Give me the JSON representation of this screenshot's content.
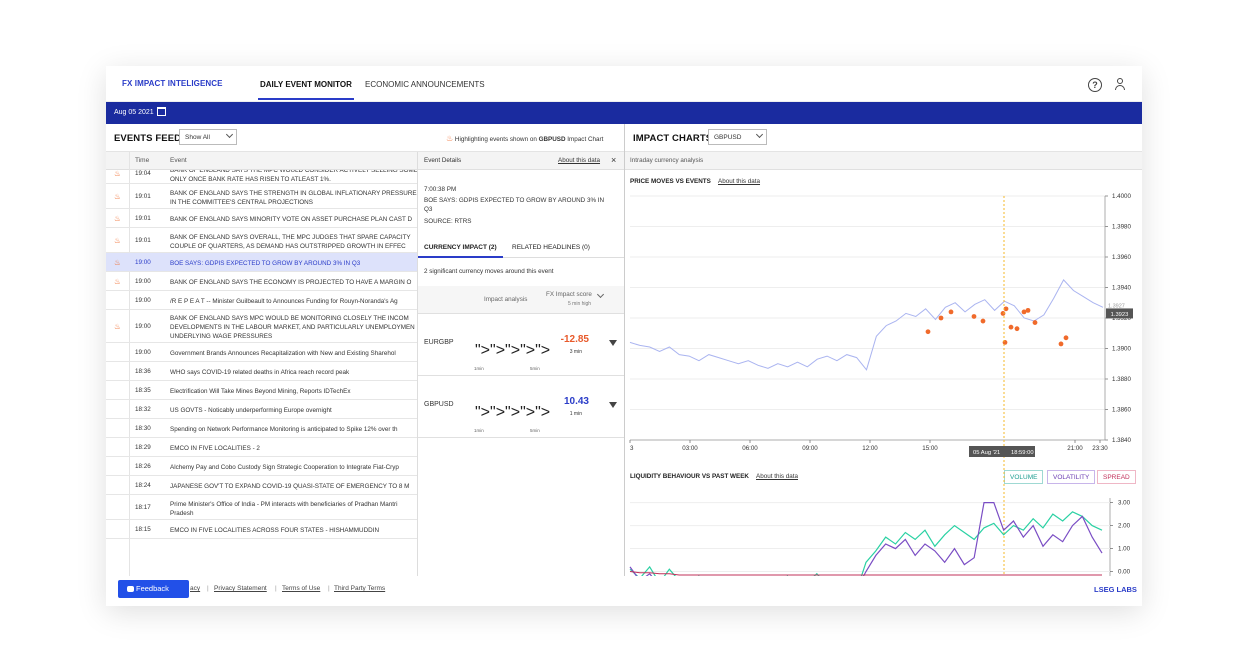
{
  "nav": {
    "brand": "FX IMPACT INTELIGENCE",
    "tab_daily": "DAILY EVENT MONITOR",
    "tab_econ": "ECONOMIC ANNOUNCEMENTS"
  },
  "datebar": {
    "date": "Aug 05 2021"
  },
  "feed": {
    "title": "EVENTS FEED",
    "filter": "Show All",
    "highlight_prefix": "Highlighting events shown on ",
    "highlight_pair": "GBPUSD",
    "highlight_suffix": " Impact Chart",
    "col_time": "Time",
    "col_event": "Event",
    "rows": [
      {
        "time": "19:04",
        "flame": true,
        "l1": "BANK OF ENGLAND SAYS THE MPC WOULD CONSIDER ACTIVELY SELLING SOME",
        "l2": "ONLY ONCE BANK RATE HAS RISEN TO ATLEAST 1%."
      },
      {
        "time": "19:01",
        "flame": true,
        "l1": "BANK OF ENGLAND SAYS THE STRENGTH IN GLOBAL INFLATIONARY PRESSURES",
        "l2": "IN THE COMMITTEE'S CENTRAL PROJECTIONS"
      },
      {
        "time": "19:01",
        "flame": true,
        "l1": "BANK OF ENGLAND SAYS MINORITY VOTE ON ASSET PURCHASE PLAN CAST D",
        "l2": ""
      },
      {
        "time": "19:01",
        "flame": true,
        "l1": "BANK OF ENGLAND SAYS OVERALL, THE MPC JUDGES THAT SPARE CAPACITY",
        "l2": "COUPLE OF     QUARTERS, AS DEMAND HAS OUTSTRIPPED GROWTH IN EFFEC"
      },
      {
        "time": "19:00",
        "flame": true,
        "l1": "BOE SAYS: GDPIS EXPECTED TO GROW BY AROUND 3% IN Q3",
        "l2": ""
      },
      {
        "time": "19:00",
        "flame": true,
        "l1": "BANK OF ENGLAND SAYS THE ECONOMY IS PROJECTED TO HAVE A MARGIN O",
        "l2": ""
      },
      {
        "time": "19:00",
        "flame": false,
        "l1": "/R E P E A T -- Minister Guilbeault to Announces Funding for Rouyn-Noranda's Ag",
        "l2": ""
      },
      {
        "time": "19:00",
        "flame": true,
        "l1": "BANK OF ENGLAND SAYS MPC WOULD BE MONITORING CLOSELY THE INCOM",
        "l2": "DEVELOPMENTS IN THE LABOUR MARKET, AND PARTICULARLY UNEMPLOYMEN",
        "l3": "UNDERLYING WAGE PRESSURES"
      },
      {
        "time": "19:00",
        "flame": false,
        "l1": "Government Brands Announces Recapitalization with New and Existing Sharehol",
        "l2": ""
      },
      {
        "time": "18:36",
        "flame": false,
        "l1": "WHO says COVID-19 related deaths in Africa reach record peak",
        "l2": ""
      },
      {
        "time": "18:35",
        "flame": false,
        "l1": "Electrification Will Take Mines Beyond Mining, Reports IDTechEx",
        "l2": ""
      },
      {
        "time": "18:32",
        "flame": false,
        "l1": "US GOVTS - Noticably underperforming Europe overnight",
        "l2": ""
      },
      {
        "time": "18:30",
        "flame": false,
        "l1": "Spending on Network Performance Monitoring is anticipated to Spike 12% over th",
        "l2": ""
      },
      {
        "time": "18:29",
        "flame": false,
        "l1": "EMCO IN FIVE LOCALITIES - 2",
        "l2": ""
      },
      {
        "time": "18:26",
        "flame": false,
        "l1": "Alchemy Pay and Cobo Custody Sign Strategic Cooperation to Integrate Fiat-Cryp",
        "l2": ""
      },
      {
        "time": "18:24",
        "flame": false,
        "l1": "JAPANESE GOV'T TO EXPAND COVID-19 QUASI-STATE OF EMERGENCY TO 8 M",
        "l2": ""
      },
      {
        "time": "18:17",
        "flame": false,
        "l1": "Prime Minister's Office of India - PM interacts with beneficiaries of Pradhan Mantri",
        "l2": "Pradesh"
      },
      {
        "time": "18:15",
        "flame": false,
        "l1": "EMCO IN FIVE LOCALITIES ACROSS FOUR STATES - HISHAMMUDDIN",
        "l2": ""
      }
    ]
  },
  "details": {
    "title": "Event Details",
    "about": "About this data",
    "time": "7:00:38 PM",
    "headline1": "BOE SAYS: GDPIS EXPECTED TO GROW BY AROUND 3% IN",
    "headline2": "Q3",
    "source": "SOURCE: RTRS",
    "tab_impact": "CURRENCY IMPACT (2)",
    "tab_headlines": "RELATED HEADLINES (0)",
    "summary": "2 significant currency moves around this event",
    "col_analysis": "Impact analysis",
    "col_score": "FX Impact score",
    "col_score_sub": "5 min high",
    "pairs": [
      {
        "name": "EURGBP",
        "score": "-12.85",
        "window": "3 min",
        "color": "#e85a2b",
        "bar": "#f6b8a6",
        "lbl1": "1min",
        "lbl2": "5min"
      },
      {
        "name": "GBPUSD",
        "score": "10.43",
        "window": "1 min",
        "color": "#2a3cc8",
        "bar": "#b9bff4",
        "lbl1": "1min",
        "lbl2": "5min"
      }
    ]
  },
  "charts": {
    "title": "IMPACT CHARTS",
    "pair": "GBPUSD",
    "subtitle": "Intraday currency analysis",
    "price_title": "PRICE MOVES VS EVENTS",
    "price_about": "About this data",
    "liq_title": "LIQUIDITY BEHAVIOUR VS PAST WEEK",
    "liq_about": "About this data",
    "toggle_volume": "VOLUME",
    "toggle_volatility": "VOLATILITY",
    "toggle_spread": "SPREAD",
    "crosshair_date": "05 Aug '21",
    "crosshair_time": "18:59:00",
    "price_tag": "1.3923",
    "price_tag_faded": "1.3927"
  },
  "chart_data": [
    {
      "type": "line",
      "title": "PRICE MOVES VS EVENTS",
      "x_ticks": [
        "3",
        "03:00",
        "06:00",
        "09:00",
        "12:00",
        "15:00",
        "21:00",
        "23:30"
      ],
      "y_ticks": [
        "1.4000",
        "1.3980",
        "1.3960",
        "1.3940",
        "1.3920",
        "1.3900",
        "1.3880",
        "1.3860",
        "1.3840"
      ],
      "ylim": [
        1.384,
        1.4
      ],
      "series": [
        {
          "values": [
            1.3904,
            1.3902,
            1.3901,
            1.3898,
            1.3901,
            1.3896,
            1.3895,
            1.3892,
            1.3896,
            1.3894,
            1.3892,
            1.389,
            1.3892,
            1.3889,
            1.3887,
            1.389,
            1.3888,
            1.3891,
            1.3888,
            1.3893,
            1.3895,
            1.3892,
            1.3896,
            1.3894,
            1.3886,
            1.3908,
            1.3915,
            1.3918,
            1.3923,
            1.3921,
            1.3926,
            1.3919,
            1.3927,
            1.393,
            1.3924,
            1.3929,
            1.3932,
            1.3925,
            1.3931,
            1.3928,
            1.392,
            1.3918,
            1.3922,
            1.3933,
            1.3945,
            1.3938,
            1.3934,
            1.393,
            1.3927
          ]
        }
      ],
      "events": [
        1.3911,
        1.392,
        1.3924,
        1.3921,
        1.3918,
        1.3923,
        1.3926,
        1.3904,
        1.3914,
        1.3913,
        1.3924,
        1.3925,
        1.3917,
        1.3903,
        1.3907
      ]
    },
    {
      "type": "line",
      "title": "LIQUIDITY BEHAVIOUR VS PAST WEEK",
      "y_ticks": [
        "3.00",
        "2.00",
        "1.00",
        "0.00",
        "-1.00"
      ],
      "ylim": [
        -1.5,
        3.2
      ],
      "series": [
        {
          "values": [
            0.1,
            -0.3,
            0.2,
            -0.5,
            0.1,
            -0.4,
            -0.6,
            -0.2,
            -0.8,
            -0.5,
            -1.1,
            -0.7,
            -1.0,
            -0.6,
            -0.9,
            -0.7,
            -0.2,
            -0.8,
            -0.5,
            -0.1,
            -0.6,
            -0.3,
            -0.7,
            -0.9,
            0.4,
            0.9,
            1.5,
            1.2,
            1.7,
            1.4,
            1.8,
            1.1,
            1.6,
            2.0,
            1.7,
            1.4,
            1.9,
            2.1,
            1.6,
            2.0,
            1.8,
            2.3,
            1.9,
            2.5,
            2.2,
            2.6,
            2.4,
            2.0,
            1.8
          ]
        },
        {
          "values": [
            0.2,
            -0.4,
            -0.1,
            -0.6,
            -0.3,
            -0.8,
            -1.0,
            -0.7,
            -1.2,
            -1.0,
            -1.3,
            -0.9,
            -1.1,
            -1.2,
            -0.8,
            -1.0,
            -0.6,
            -0.9,
            -0.4,
            -0.7,
            -1.0,
            -0.5,
            -0.9,
            -0.8,
            0.0,
            0.7,
            1.2,
            1.0,
            1.4,
            0.7,
            1.2,
            0.9,
            0.4,
            1.0,
            0.3,
            0.6,
            3.0,
            3.0,
            1.8,
            2.2,
            1.5,
            2.0,
            1.1,
            1.6,
            1.3,
            2.0,
            2.4,
            1.5,
            0.8
          ]
        },
        {
          "values": [
            0.0,
            -0.05,
            -0.05,
            -0.1,
            -0.1,
            -0.15,
            -0.15,
            -0.15,
            -0.15,
            -0.15,
            -0.15,
            -0.15,
            -0.15,
            -0.15,
            -0.15,
            -0.15,
            -0.15,
            -0.15,
            -0.15,
            -0.15,
            -0.15,
            -0.15,
            -0.15,
            -0.15,
            -0.15,
            -0.15,
            -0.15,
            -0.15,
            -0.15,
            -0.15,
            -0.15,
            -0.15,
            -0.15,
            -0.15,
            -0.15,
            -0.15,
            -0.15,
            -0.15,
            -0.15,
            -0.15,
            -0.15,
            -0.15,
            -0.15,
            -0.15,
            -0.15,
            -0.15,
            -0.15,
            -0.15,
            -0.15
          ]
        }
      ]
    }
  ],
  "footer": {
    "privacy": "acy",
    "privacy_statement": "Privacy Statement",
    "terms": "Terms of Use",
    "third_party": "Third Party Terms",
    "brand": "LSEG LABS",
    "feedback": "Feedback"
  },
  "colors": {
    "accent": "#2a3cc8",
    "datebar": "#1a2b9f",
    "price": "#aab4f0",
    "event": "#f06a2b",
    "teal": "#2ad1a3",
    "purple": "#7a4dc4",
    "red": "#c2305a"
  }
}
